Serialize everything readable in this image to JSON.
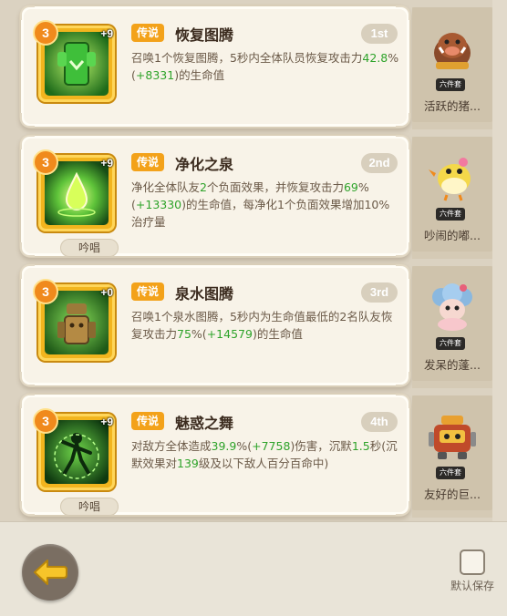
{
  "skills": [
    {
      "level": "3",
      "plus": "+9",
      "rarity": "传说",
      "name": "恢复图腾",
      "rank": "1st",
      "chant": "",
      "desc": [
        {
          "t": "召唤1个恢复图腾，5秒内全体队员恢复攻击力"
        },
        {
          "t": "42.8",
          "c": "hl"
        },
        {
          "t": "%("
        },
        {
          "t": "+8331",
          "c": "hl"
        },
        {
          "t": ")的生命值"
        }
      ],
      "icon": "totem-icon",
      "pet": {
        "tag": "六件套",
        "name": "活跃的猪...",
        "icon": "boar-pet-icon"
      }
    },
    {
      "level": "3",
      "plus": "+9",
      "rarity": "传说",
      "name": "净化之泉",
      "rank": "2nd",
      "chant": "吟唱",
      "desc": [
        {
          "t": "净化全体队友"
        },
        {
          "t": "2",
          "c": "hl"
        },
        {
          "t": "个负面效果，并恢复攻击力"
        },
        {
          "t": "69",
          "c": "hl"
        },
        {
          "t": "%("
        },
        {
          "t": "+13330",
          "c": "hl"
        },
        {
          "t": ")的生命值，每净化1个负面效果增加10%治疗量"
        }
      ],
      "icon": "droplet-icon",
      "pet": {
        "tag": "六件套",
        "name": "吵闹的嘟...",
        "icon": "bird-pet-icon"
      }
    },
    {
      "level": "3",
      "plus": "+0",
      "rarity": "传说",
      "name": "泉水图腾",
      "rank": "3rd",
      "chant": "",
      "desc": [
        {
          "t": "召唤1个泉水图腾，5秒内为生命值最低的2名队友恢复攻击力"
        },
        {
          "t": "75",
          "c": "hl"
        },
        {
          "t": "%("
        },
        {
          "t": "+14579",
          "c": "hl"
        },
        {
          "t": ")的生命值"
        }
      ],
      "icon": "spring-totem-icon",
      "pet": {
        "tag": "六件套",
        "name": "发呆的蓬...",
        "icon": "sheep-pet-icon"
      }
    },
    {
      "level": "3",
      "plus": "+9",
      "rarity": "传说",
      "name": "魅惑之舞",
      "rank": "4th",
      "chant": "吟唱",
      "desc": [
        {
          "t": "对敌方全体造成"
        },
        {
          "t": "39.9",
          "c": "hl"
        },
        {
          "t": "%("
        },
        {
          "t": "+7758",
          "c": "hl"
        },
        {
          "t": ")伤害，沉默"
        },
        {
          "t": "1.5",
          "c": "hl"
        },
        {
          "t": "秒(沉默效果对"
        },
        {
          "t": "139",
          "c": "hl"
        },
        {
          "t": "级及以下敌人百分百命中)"
        }
      ],
      "icon": "dancer-icon",
      "pet": {
        "tag": "六件套",
        "name": "友好的巨...",
        "icon": "robot-pet-icon"
      }
    }
  ],
  "footer": {
    "save_label": "默认保存"
  }
}
